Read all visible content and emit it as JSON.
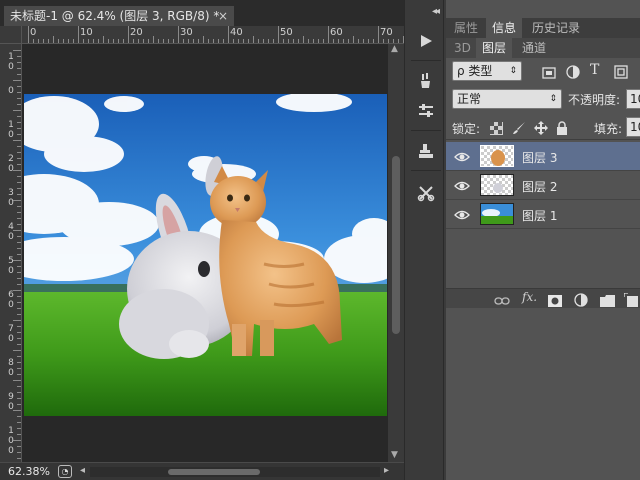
{
  "document": {
    "tab_title": "未标题-1 @ 62.4% (图层 3, RGB/8) *",
    "close_glyph": "×"
  },
  "ruler": {
    "h_labels": [
      "0",
      "10",
      "20",
      "30",
      "40",
      "50",
      "60",
      "70"
    ],
    "v_labels": [
      [
        "1",
        "0"
      ],
      [
        "0"
      ],
      [
        "1",
        "0"
      ],
      [
        "2",
        "0"
      ],
      [
        "3",
        "0"
      ],
      [
        "4",
        "0"
      ],
      [
        "5",
        "0"
      ],
      [
        "6",
        "0"
      ],
      [
        "7",
        "0"
      ],
      [
        "8",
        "0"
      ],
      [
        "9",
        "0"
      ],
      [
        "1",
        "0",
        "0"
      ]
    ]
  },
  "status": {
    "zoom": "62.38%"
  },
  "panel": {
    "tabs_top": [
      "属性",
      "信息",
      "历史记录"
    ],
    "tabs_second": [
      "3D",
      "图层",
      "通道"
    ],
    "filter": {
      "label": "ρ 类型"
    },
    "blend": {
      "mode": "正常",
      "opacity_label": "不透明度:",
      "opacity_value": "10"
    },
    "lock": {
      "label": "锁定:",
      "fill_label": "填充:",
      "fill_value": "10"
    },
    "layers": [
      {
        "name": "图层 3",
        "selected": true,
        "thumb": "cat"
      },
      {
        "name": "图层 2",
        "selected": false,
        "thumb": "rabbit"
      },
      {
        "name": "图层 1",
        "selected": false,
        "thumb": "landscape"
      }
    ],
    "footer_icons": [
      "link-icon",
      "fx-icon",
      "mask-icon",
      "adjustment-icon",
      "folder-icon",
      "new-layer-icon"
    ]
  },
  "colors": {
    "selected_layer": "#5e6f8f",
    "panel_bg": "#535353",
    "sky_top": "#1f6fc4",
    "grass": "#3e9e1e"
  }
}
